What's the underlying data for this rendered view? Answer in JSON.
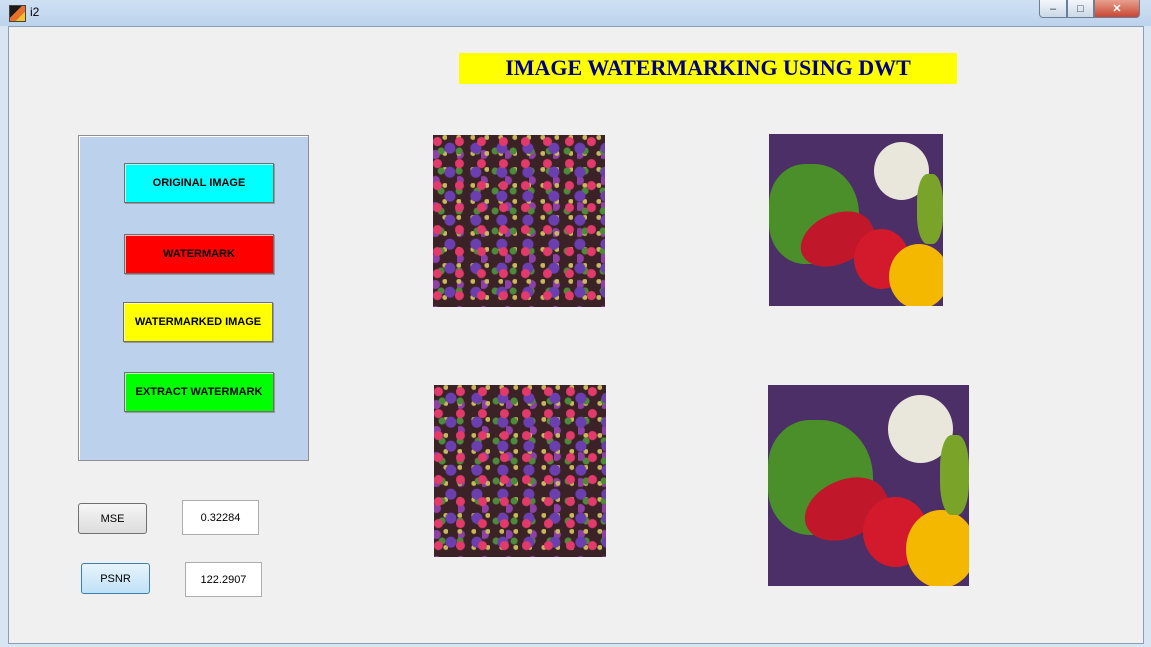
{
  "window": {
    "title": "i2"
  },
  "banner": {
    "title": "IMAGE WATERMARKING USING DWT"
  },
  "panel": {
    "buttons": [
      {
        "label": "ORIGINAL IMAGE",
        "color": "#00ffff"
      },
      {
        "label": "WATERMARK",
        "color": "#ff0000"
      },
      {
        "label": "WATERMARKED IMAGE",
        "color": "#ffff00"
      },
      {
        "label": "EXTRACT WATERMARK",
        "color": "#00ff00"
      }
    ]
  },
  "metrics": {
    "mse": {
      "label": "MSE",
      "value": "0.32284"
    },
    "psnr": {
      "label": "PSNR",
      "value": "122.2907"
    }
  },
  "images": [
    {
      "name": "original-image",
      "kind": "floral fabric"
    },
    {
      "name": "watermark-image",
      "kind": "peppers"
    },
    {
      "name": "watermarked-image",
      "kind": "floral fabric"
    },
    {
      "name": "extracted-watermark-image",
      "kind": "peppers"
    }
  ],
  "colors": {
    "banner_bg": "#ffff00",
    "banner_text": "#000080",
    "panel_bg": "#bcd2ec"
  }
}
